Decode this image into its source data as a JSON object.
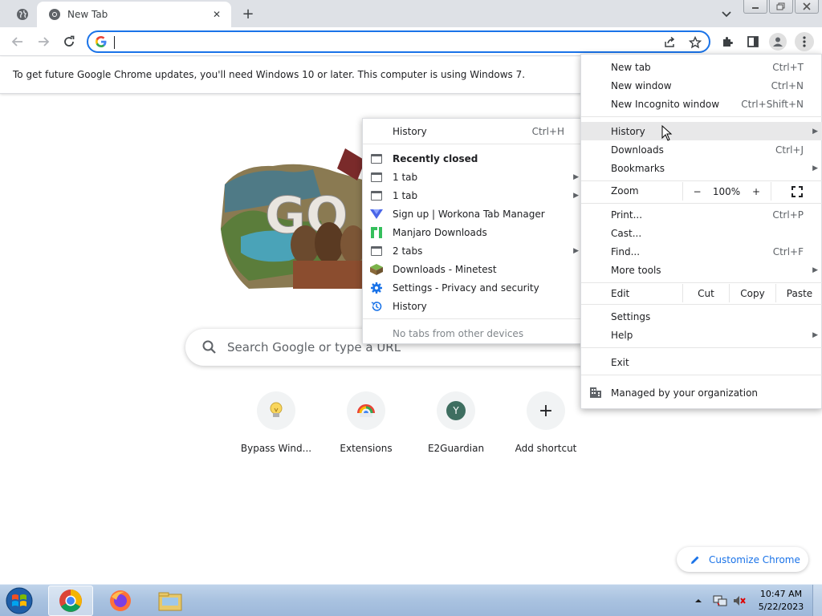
{
  "browser": {
    "tabs": [
      {
        "title": "New Tab",
        "active": true
      }
    ],
    "close_tab_glyph": "✕",
    "new_tab_glyph": "+",
    "omnibox": {
      "value": "",
      "placeholder": ""
    }
  },
  "infobar": {
    "message": "To get future Google Chrome updates, you'll need Windows 10 or later. This computer is using Windows 7."
  },
  "ntp": {
    "doodle_text": "GO",
    "search_placeholder": "Search Google or type a URL",
    "shortcuts": [
      {
        "label": "Bypass Wind...",
        "icon": "lightbulb-icon"
      },
      {
        "label": "Extensions",
        "icon": "chrome-webstore-icon"
      },
      {
        "label": "E2Guardian",
        "icon": "letter-avatar-icon",
        "letter": "Y"
      },
      {
        "label": "Add shortcut",
        "icon": "plus-icon",
        "glyph": "+"
      }
    ],
    "customize_label": "Customize Chrome"
  },
  "menu": {
    "new_tab": {
      "label": "New tab",
      "shortcut": "Ctrl+T"
    },
    "new_window": {
      "label": "New window",
      "shortcut": "Ctrl+N"
    },
    "new_incognito": {
      "label": "New Incognito window",
      "shortcut": "Ctrl+Shift+N"
    },
    "history": {
      "label": "History"
    },
    "downloads": {
      "label": "Downloads",
      "shortcut": "Ctrl+J"
    },
    "bookmarks": {
      "label": "Bookmarks"
    },
    "zoom": {
      "label": "Zoom",
      "minus": "−",
      "value": "100%",
      "plus": "+"
    },
    "print": {
      "label": "Print...",
      "shortcut": "Ctrl+P"
    },
    "cast": {
      "label": "Cast..."
    },
    "find": {
      "label": "Find...",
      "shortcut": "Ctrl+F"
    },
    "more_tools": {
      "label": "More tools"
    },
    "edit": {
      "label": "Edit",
      "cut": "Cut",
      "copy": "Copy",
      "paste": "Paste"
    },
    "settings": {
      "label": "Settings"
    },
    "help": {
      "label": "Help"
    },
    "exit": {
      "label": "Exit"
    },
    "managed": {
      "label": "Managed by your organization"
    }
  },
  "history_submenu": {
    "history": {
      "label": "History",
      "shortcut": "Ctrl+H"
    },
    "recently_closed_label": "Recently closed",
    "items": [
      {
        "label": "1 tab",
        "icon": "tab-icon",
        "has_submenu": true
      },
      {
        "label": "1 tab",
        "icon": "tab-icon",
        "has_submenu": true
      },
      {
        "label": "Sign up | Workona Tab Manager",
        "icon": "workona-icon",
        "has_submenu": false
      },
      {
        "label": "Manjaro Downloads",
        "icon": "manjaro-icon",
        "has_submenu": false
      },
      {
        "label": "2 tabs",
        "icon": "tab-icon",
        "has_submenu": true
      },
      {
        "label": "Downloads - Minetest",
        "icon": "minetest-icon",
        "has_submenu": false
      },
      {
        "label": "Settings - Privacy and security",
        "icon": "settings-gear-icon",
        "has_submenu": false
      },
      {
        "label": "History",
        "icon": "history-icon",
        "has_submenu": false
      }
    ],
    "no_tabs_label": "No tabs from other devices"
  },
  "taskbar": {
    "apps": [
      "chrome-icon",
      "firefox-icon",
      "file-explorer-icon"
    ],
    "time": "10:47 AM",
    "date": "5/22/2023"
  },
  "colors": {
    "accent": "#1a73e8",
    "tabstrip": "#dee1e6",
    "menu_highlight": "#e8e8e9"
  }
}
